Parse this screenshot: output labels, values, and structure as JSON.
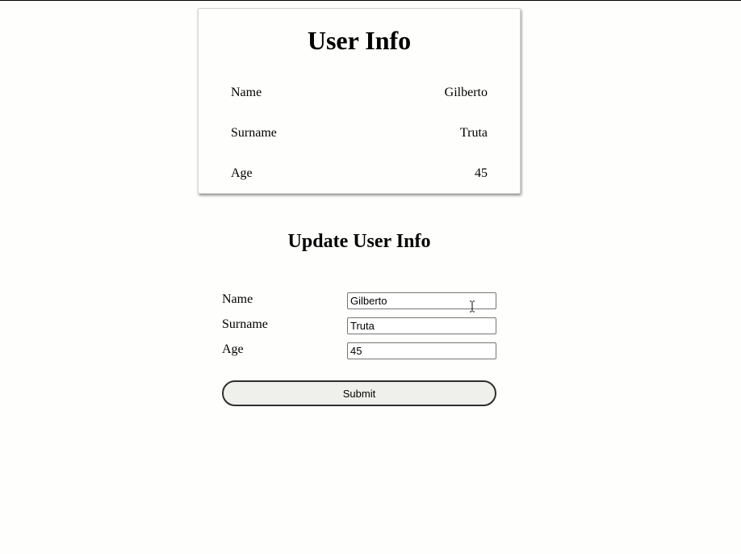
{
  "user_info": {
    "title": "User Info",
    "rows": [
      {
        "label": "Name",
        "value": "Gilberto"
      },
      {
        "label": "Surname",
        "value": "Truta"
      },
      {
        "label": "Age",
        "value": "45"
      }
    ]
  },
  "update_form": {
    "title": "Update User Info",
    "fields": [
      {
        "label": "Name",
        "value": "Gilberto"
      },
      {
        "label": "Surname",
        "value": "Truta"
      },
      {
        "label": "Age",
        "value": "45"
      }
    ],
    "submit_label": "Submit"
  }
}
